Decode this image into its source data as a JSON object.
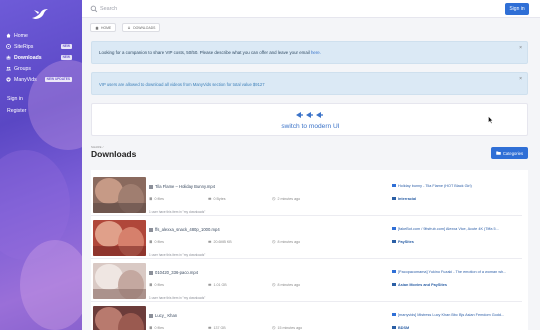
{
  "sidebar": {
    "items": [
      {
        "label": "Home",
        "icon": "home-icon",
        "badge": ""
      },
      {
        "label": "SiteRips",
        "icon": "disc-icon",
        "badge": "NEW"
      },
      {
        "label": "Downloads",
        "icon": "download-icon",
        "badge": "NEW"
      },
      {
        "label": "Groups",
        "icon": "users-icon",
        "badge": ""
      },
      {
        "label": "ManyVids",
        "icon": "heart-icon",
        "badge": "NEW UPDATES"
      }
    ],
    "signin_label": "Sign in",
    "register_label": "Register"
  },
  "topbar": {
    "search_placeholder": "Search",
    "signin_button": "Sign in"
  },
  "breadcrumbs": [
    "HOME",
    "DOWNLOADS"
  ],
  "alerts": [
    {
      "text": "Looking for a companion to share VIP costs, 50/50. Please describe what you can offer and leave your email ",
      "link": "here."
    },
    {
      "text": "VIP users are allowed to download all videos from ManyVids section for total value $9127"
    }
  ],
  "switch": {
    "label": "switch to modern UI"
  },
  "page": {
    "small_label": "SHARE /",
    "title": "Downloads",
    "categories_button": "Categories"
  },
  "downloads": [
    {
      "file": "Tila Flame – Holiday Bunny.mp4",
      "files": "0 files",
      "size": "0 Bytes",
      "time": "2 minutes ago",
      "forum_title": "Holiday bunny - Tila Flame (HOT Black Girl)",
      "category": "Interracial",
      "owned": "1 user have this item in \"my downloads\"",
      "thumb_colors": [
        "#8a6a5e",
        "#c69a86",
        "#5e4a44",
        "#a07e70"
      ]
    },
    {
      "file": "ffs_alexxa_snack_480p_1000.mp4",
      "files": "0 files",
      "size": "20.6MB KB",
      "time": "8 minutes ago",
      "forum_title": "[fakeBot.com / 9ltsfrub.com] Alexxa Vice, Acute 4K (Tiffa 5...",
      "category": "PaySites",
      "owned": "1 user have this item in \"my downloads\"",
      "thumb_colors": [
        "#b0473a",
        "#e0a08a",
        "#7a2a24",
        "#d6806c"
      ]
    },
    {
      "file": "010420_336-paco.mp4",
      "files": "0 files",
      "size": "1.01 GB",
      "time": "8 minutes ago",
      "forum_title": "[Pacopacomama] Yukino Fuzaki - The emotion of a woman wh...",
      "category": "Asian Movies and PaySites",
      "owned": "1 user have this item in \"my downloads\"",
      "thumb_colors": [
        "#d9c9c4",
        "#efe6e2",
        "#8c6e68",
        "#c4a8a0"
      ]
    },
    {
      "file": "Lucy_ Khan",
      "files": "0 files",
      "size": "137 GB",
      "time": "15 minutes ago",
      "forum_title": "[manyvids] Mistress Lucy Khan Bbc Bjs Asian Femdom Godd...",
      "category": "BDSM",
      "owned": "",
      "thumb_colors": [
        "#6c3c3a",
        "#b87a6e",
        "#3e2220",
        "#9a5a50"
      ]
    }
  ]
}
